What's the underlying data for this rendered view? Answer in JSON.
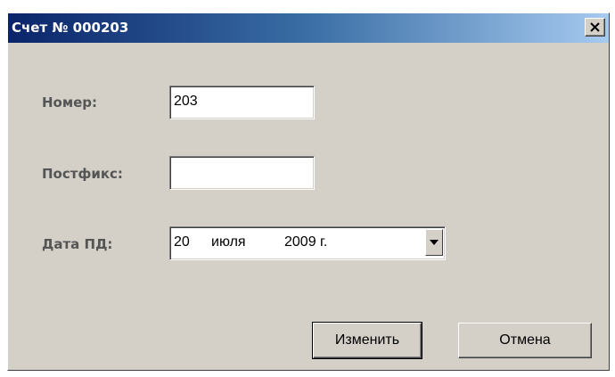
{
  "window": {
    "title": "Счет № 000203"
  },
  "form": {
    "number_label": "Номер:",
    "number_value": "203",
    "postfix_label": "Постфикс:",
    "postfix_value": "",
    "date_label": "Дата ПД:",
    "date_day": "20",
    "date_month": "июля",
    "date_year": "2009 г."
  },
  "buttons": {
    "change_label": "Изменить",
    "cancel_label": "Отмена"
  },
  "icons": {
    "close": "close-icon",
    "dropdown": "chevron-down-icon"
  }
}
